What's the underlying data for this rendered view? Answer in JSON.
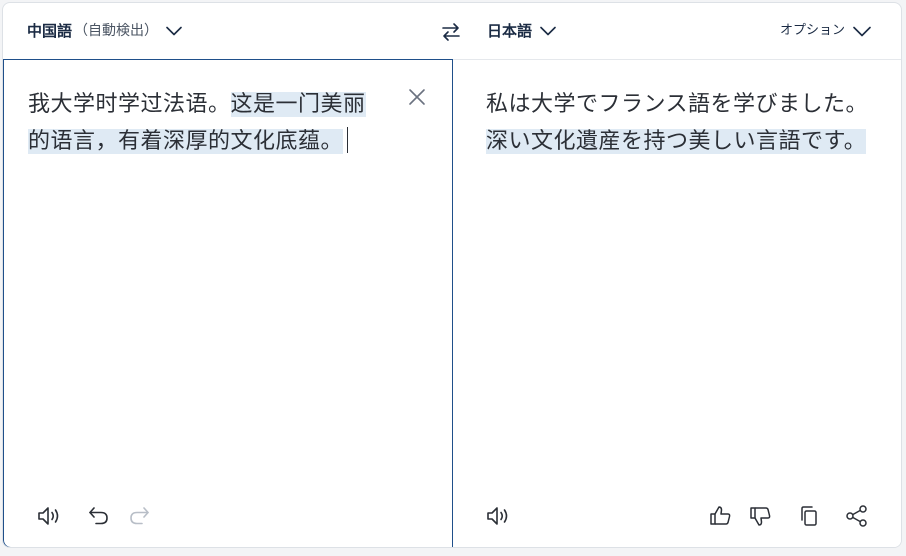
{
  "source": {
    "language": "中国語",
    "detect_label": "（自動検出）",
    "text_plain": "我大学时学过法语。",
    "text_highlight": "这是一门美丽的语言，有着深厚的文化底蕴。"
  },
  "target": {
    "language": "日本語",
    "options_label": "オプション",
    "text_plain": "私は大学でフランス語を学びました。",
    "text_highlight": "深い文化遺産を持つ美しい言語です。"
  },
  "icons": {
    "swap": "swap-arrows-icon",
    "clear": "close-icon",
    "listen": "speaker-icon",
    "undo": "undo-icon",
    "redo": "redo-icon",
    "thumbs_up": "thumbs-up-icon",
    "thumbs_down": "thumbs-down-icon",
    "copy": "copy-icon",
    "share": "share-icon"
  },
  "colors": {
    "accent_border": "#1f4f8a",
    "highlight": "#dfeaf4",
    "text": "#2b2f36",
    "label": "#1b2b44"
  }
}
